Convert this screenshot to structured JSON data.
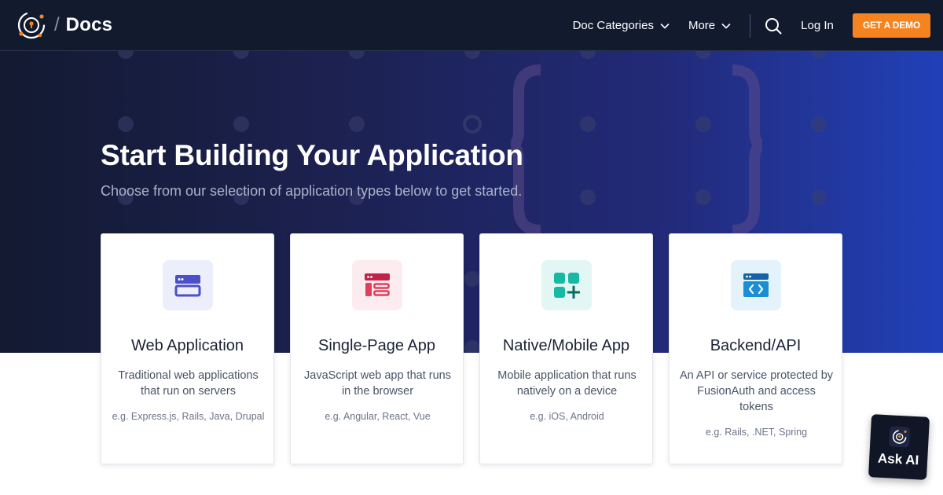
{
  "nav": {
    "brand": "Docs",
    "slash": "/",
    "doc_categories": "Doc Categories",
    "more": "More",
    "login": "Log In",
    "demo": "GET A DEMO"
  },
  "hero": {
    "title": "Start Building Your Application",
    "subtitle": "Choose from our selection of application types below to get started."
  },
  "cards": [
    {
      "title": "Web Application",
      "description": "Traditional web applications that run on servers",
      "examples": "e.g. Express.js, Rails, Java, Drupal",
      "icon": "browser-window-icon",
      "icon_color": "#4b4fc9",
      "icon_bg": "#eceefc"
    },
    {
      "title": "Single-Page App",
      "description": "JavaScript web app that runs in the browser",
      "examples": "e.g. Angular, React, Vue",
      "icon": "page-layout-icon",
      "icon_color": "#e0405a",
      "icon_bg": "#fdecef"
    },
    {
      "title": "Native/Mobile App",
      "description": "Mobile application that runs natively on a device",
      "examples": "e.g. iOS, Android",
      "icon": "app-grid-plus-icon",
      "icon_color": "#17b8a4",
      "icon_bg": "#e2f7f4"
    },
    {
      "title": "Backend/API",
      "description": "An API or service protected by FusionAuth and access tokens",
      "examples": "e.g. Rails, .NET, Spring",
      "icon": "code-window-icon",
      "icon_color": "#1a8fd6",
      "icon_bg": "#e3f2fb"
    }
  ],
  "ask_ai": {
    "label": "Ask AI"
  },
  "colors": {
    "nav_bg": "#121a2e",
    "accent": "#f58320",
    "hero_start": "#131a31",
    "hero_end": "#2140b8"
  }
}
